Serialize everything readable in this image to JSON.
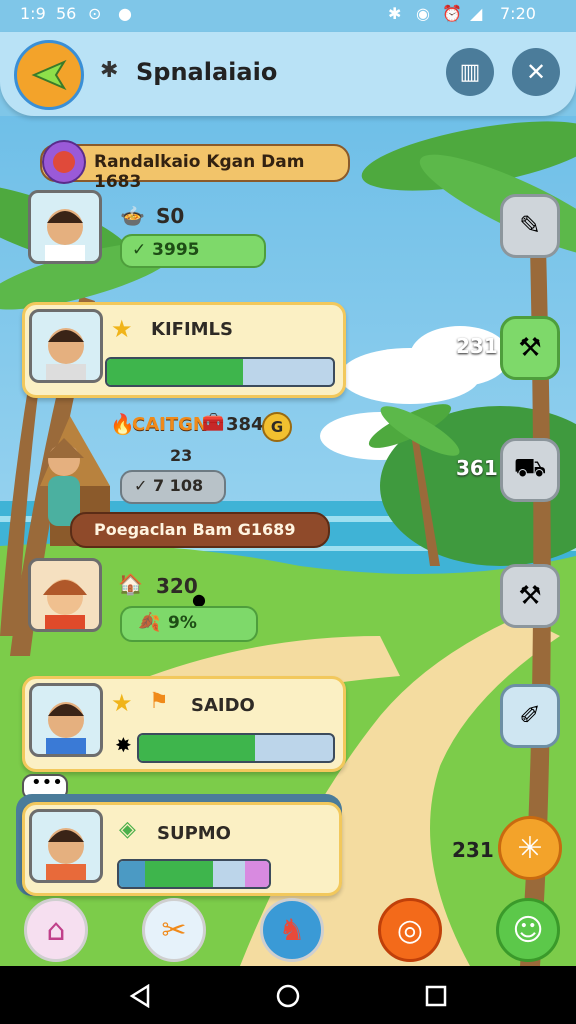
{
  "status": {
    "time": "1:9",
    "left2": "56",
    "right_time": "7:20"
  },
  "header": {
    "title": "Spnalaiaio"
  },
  "banner_top": {
    "text": "Randalkaio Kgan Dam 1683"
  },
  "cards": [
    {
      "value": "S0",
      "pill": "✓ 3995"
    },
    {
      "label": "KIFIMLS",
      "progress": 0.6
    },
    {
      "value": "320",
      "pill": "9%"
    },
    {
      "label": "SAIDO",
      "progress": 0.6
    },
    {
      "label": "SUPMO"
    }
  ],
  "mid_row": {
    "label": "CAITGN",
    "value": "384",
    "badge": "G",
    "sub": "23",
    "pill": "✓ 7  108"
  },
  "banner_mid": {
    "text": "Poegaclan Bam G1689"
  },
  "side_numbers": [
    "231",
    "361",
    "231"
  ],
  "colors": {
    "accent_green": "#3eb54c",
    "gold": "#f2c85c",
    "sky": "#7fc6e8"
  }
}
